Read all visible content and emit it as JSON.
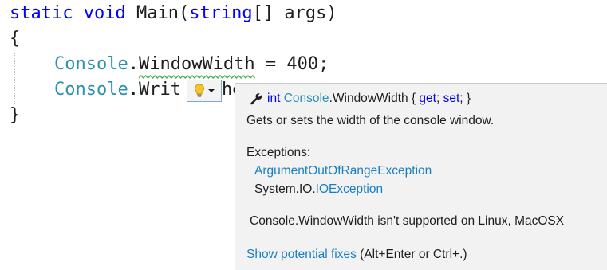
{
  "code": {
    "line1": {
      "keyword_static": "static",
      "keyword_void": "void",
      "method": "Main(",
      "keyword_string": "string",
      "rest": "[] args)"
    },
    "line2": {
      "brace": "{"
    },
    "line3": {
      "type": "Console",
      "dot": ".",
      "member": "WindowWidth",
      "rest": " = 400;"
    },
    "line4": {
      "type": "Console",
      "dot": ".",
      "member_partial": "Writ",
      "after_bulb": "he"
    },
    "line5": {
      "brace": "}"
    }
  },
  "quick_info": {
    "icon": "wrench-icon",
    "signature": {
      "return_type": "int",
      "class_name": "Console",
      "member": ".WindowWidth { ",
      "get": "get",
      "sep": "; ",
      "set": "set",
      "end": "; }"
    },
    "description": "Gets or sets the width of the console window.",
    "exceptions_heading": "Exceptions:",
    "exception1": "ArgumentOutOfRangeException",
    "exception2_prefix": "System.IO.",
    "exception2_type": "IOException",
    "platform_note": "Console.WindowWidth isn't supported on Linux, MacOSX",
    "fixes_link": "Show potential fixes",
    "fixes_shortcut": " (Alt+Enter or Ctrl+.)"
  },
  "lightbulb": {
    "icon": "lightbulb-icon",
    "dropdown_icon": "dropdown-arrow-icon"
  },
  "colors": {
    "keyword": "#0000ff",
    "type": "#2b91af",
    "squiggle": "#4caf50",
    "link": "#1a7fc1",
    "tooltip_bg": "#f2f2f2"
  }
}
